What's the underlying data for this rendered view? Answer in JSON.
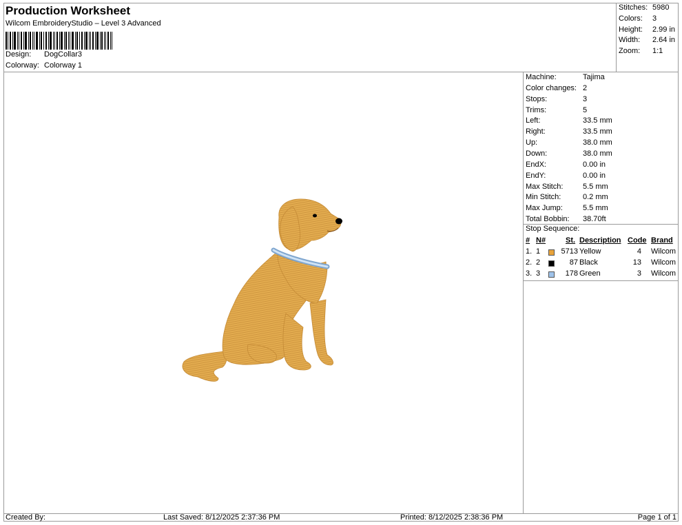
{
  "header": {
    "title": "Production Worksheet",
    "subtitle": "Wilcom EmbroideryStudio – Level 3 Advanced",
    "design_label": "Design:",
    "design_value": "DogCollar3",
    "colorway_label": "Colorway:",
    "colorway_value": "Colorway 1"
  },
  "stats": [
    {
      "label": "Stitches:",
      "value": "5980"
    },
    {
      "label": "Colors:",
      "value": "3"
    },
    {
      "label": "Height:",
      "value": "2.99 in"
    },
    {
      "label": "Width:",
      "value": "2.64 in"
    },
    {
      "label": "Zoom:",
      "value": "1:1"
    }
  ],
  "machine_info": [
    {
      "label": "Machine:",
      "value": "Tajima"
    },
    {
      "label": "Color changes:",
      "value": "2"
    },
    {
      "label": "Stops:",
      "value": "3"
    },
    {
      "label": "Trims:",
      "value": "5"
    },
    {
      "label": "Left:",
      "value": "33.5 mm"
    },
    {
      "label": "Right:",
      "value": "33.5 mm"
    },
    {
      "label": "Up:",
      "value": "38.0 mm"
    },
    {
      "label": "Down:",
      "value": "38.0 mm"
    },
    {
      "label": "EndX:",
      "value": "0.00 in"
    },
    {
      "label": "EndY:",
      "value": "0.00 in"
    },
    {
      "label": "Max Stitch:",
      "value": "5.5 mm"
    },
    {
      "label": "Min Stitch:",
      "value": "0.2 mm"
    },
    {
      "label": "Max Jump:",
      "value": "5.5 mm"
    },
    {
      "label": "Total Bobbin:",
      "value": "38.70ft"
    }
  ],
  "stop_sequence": {
    "label": "Stop Sequence:",
    "headers": {
      "num": "#",
      "n": "N#",
      "st": "St.",
      "desc": "Description",
      "code": "Code",
      "brand": "Brand"
    },
    "rows": [
      {
        "num": "1.",
        "n": "1",
        "color": "#e8a33a",
        "st": "5713",
        "desc": "Yellow",
        "code": "4",
        "brand": "Wilcom"
      },
      {
        "num": "2.",
        "n": "2",
        "color": "#000000",
        "st": "87",
        "desc": "Black",
        "code": "13",
        "brand": "Wilcom"
      },
      {
        "num": "3.",
        "n": "3",
        "color": "#9fc3ea",
        "st": "178",
        "desc": "Green",
        "code": "3",
        "brand": "Wilcom"
      }
    ]
  },
  "footer": {
    "created_by": "Created By:",
    "last_saved": "Last Saved: 8/12/2025 2:37:36 PM",
    "printed": "Printed: 8/12/2025 2:38:36 PM",
    "page": "Page 1 of 1"
  },
  "design_colors": {
    "fur": "#e3ac4f",
    "fur_dark": "#c9913a",
    "collar": "#9fc3ea",
    "eye_nose": "#000000"
  }
}
